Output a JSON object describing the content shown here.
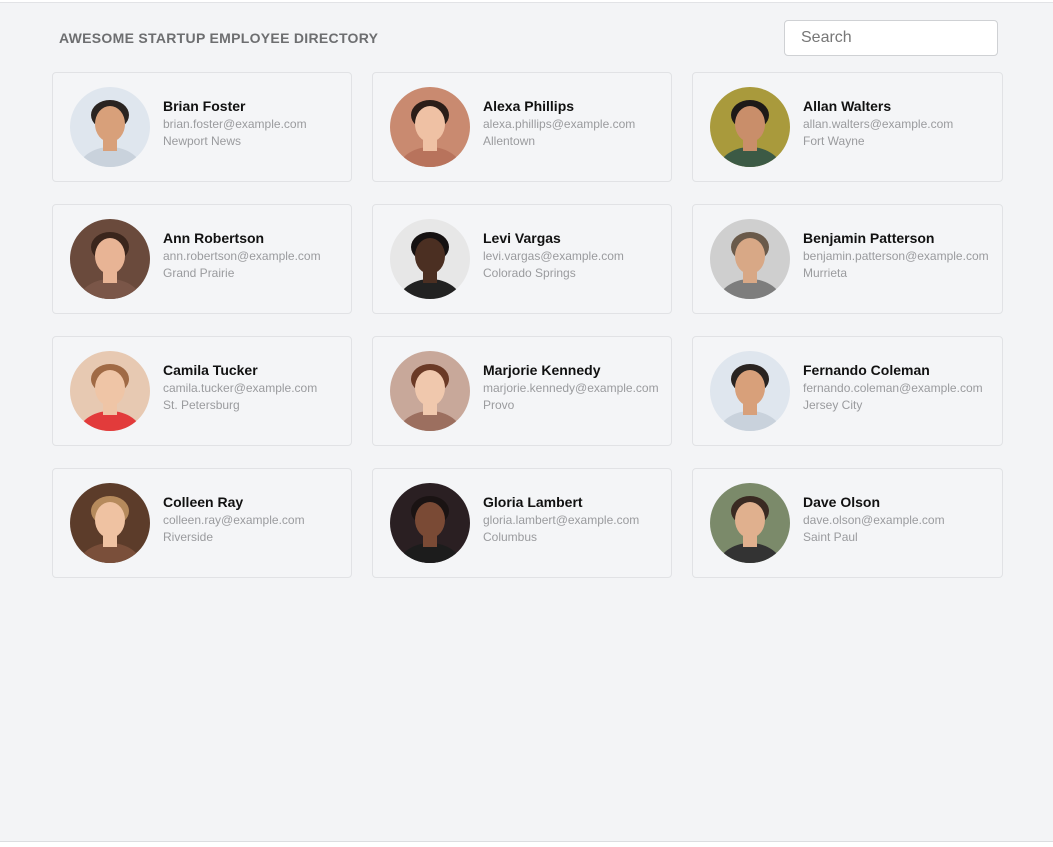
{
  "header": {
    "title": "AWESOME STARTUP EMPLOYEE DIRECTORY"
  },
  "search": {
    "placeholder": "Search",
    "value": ""
  },
  "employees": [
    {
      "name": "Brian Foster",
      "email": "brian.foster@example.com",
      "city": "Newport News",
      "bg": "#dfe6ee",
      "skin": "#d8a07a",
      "hair": "#2a2421",
      "shirt": "#c9d2dc"
    },
    {
      "name": "Alexa Phillips",
      "email": "alexa.phillips@example.com",
      "city": "Allentown",
      "bg": "#c98a70",
      "skin": "#efc1a4",
      "hair": "#2b1d18",
      "shirt": "#b8735c"
    },
    {
      "name": "Allan Walters",
      "email": "allan.walters@example.com",
      "city": "Fort Wayne",
      "bg": "#a99a3c",
      "skin": "#c98e6a",
      "hair": "#1d1a18",
      "shirt": "#3c5a45"
    },
    {
      "name": "Ann Robertson",
      "email": "ann.robertson@example.com",
      "city": "Grand Prairie",
      "bg": "#6a4a3c",
      "skin": "#e8b495",
      "hair": "#3a251c",
      "shirt": "#7a5648"
    },
    {
      "name": "Levi Vargas",
      "email": "levi.vargas@example.com",
      "city": "Colorado Springs",
      "bg": "#e7e7e7",
      "skin": "#4b2f22",
      "hair": "#151111",
      "shirt": "#222"
    },
    {
      "name": "Benjamin Patterson",
      "email": "benjamin.patterson@example.com",
      "city": "Murrieta",
      "bg": "#cfcfcf",
      "skin": "#d8a886",
      "hair": "#6a5a4a",
      "shirt": "#7d7d7d"
    },
    {
      "name": "Camila Tucker",
      "email": "camila.tucker@example.com",
      "city": "St. Petersburg",
      "bg": "#e7c9b2",
      "skin": "#efc5a6",
      "hair": "#a06a45",
      "shirt": "#e23b3b"
    },
    {
      "name": "Marjorie Kennedy",
      "email": "marjorie.kennedy@example.com",
      "city": "Provo",
      "bg": "#c8a89a",
      "skin": "#f0c8ad",
      "hair": "#6b3a26",
      "shirt": "#9c6f5f"
    },
    {
      "name": "Fernando Coleman",
      "email": "fernando.coleman@example.com",
      "city": "Jersey City",
      "bg": "#dfe6ee",
      "skin": "#d8a07a",
      "hair": "#2a2421",
      "shirt": "#c9d2dc"
    },
    {
      "name": "Colleen Ray",
      "email": "colleen.ray@example.com",
      "city": "Riverside",
      "bg": "#5c3c2a",
      "skin": "#efc2a2",
      "hair": "#b68a5c",
      "shirt": "#7a4f3a"
    },
    {
      "name": "Gloria Lambert",
      "email": "gloria.lambert@example.com",
      "city": "Columbus",
      "bg": "#2a1f22",
      "skin": "#7a4a35",
      "hair": "#1a1313",
      "shirt": "#1c1c1c"
    },
    {
      "name": "Dave Olson",
      "email": "dave.olson@example.com",
      "city": "Saint Paul",
      "bg": "#7b8a6a",
      "skin": "#e0b08e",
      "hair": "#3a2a22",
      "shirt": "#333333"
    }
  ]
}
